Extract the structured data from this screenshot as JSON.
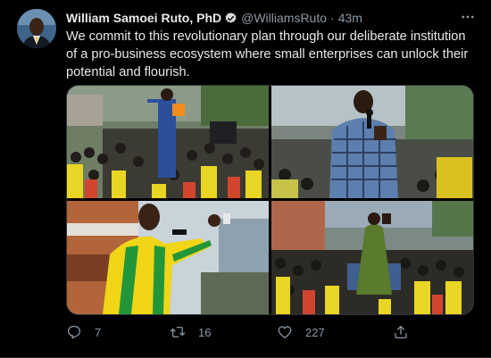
{
  "author": {
    "name": "William Samoei Ruto, PhD",
    "handle": "@WilliamsRuto",
    "separator": "·",
    "time": "43m"
  },
  "tweet": {
    "text": "We commit to this revolutionary plan through our deliberate institution of a pro-business ecosystem where small enterprises can unlock their potential and flourish."
  },
  "actions": {
    "replies": "7",
    "retweets": "16",
    "likes": "227"
  },
  "icons": {
    "more": "more-icon",
    "verified": "verified-badge-icon",
    "reply": "reply-icon",
    "retweet": "retweet-icon",
    "like": "heart-icon",
    "share": "share-icon"
  },
  "colors": {
    "background": "#000000",
    "text": "#e7e9ea",
    "muted": "#8b98a5",
    "verified": "#d9d9d9",
    "party_yellow": "#f5d313",
    "party_green": "#1f8a2e"
  }
}
